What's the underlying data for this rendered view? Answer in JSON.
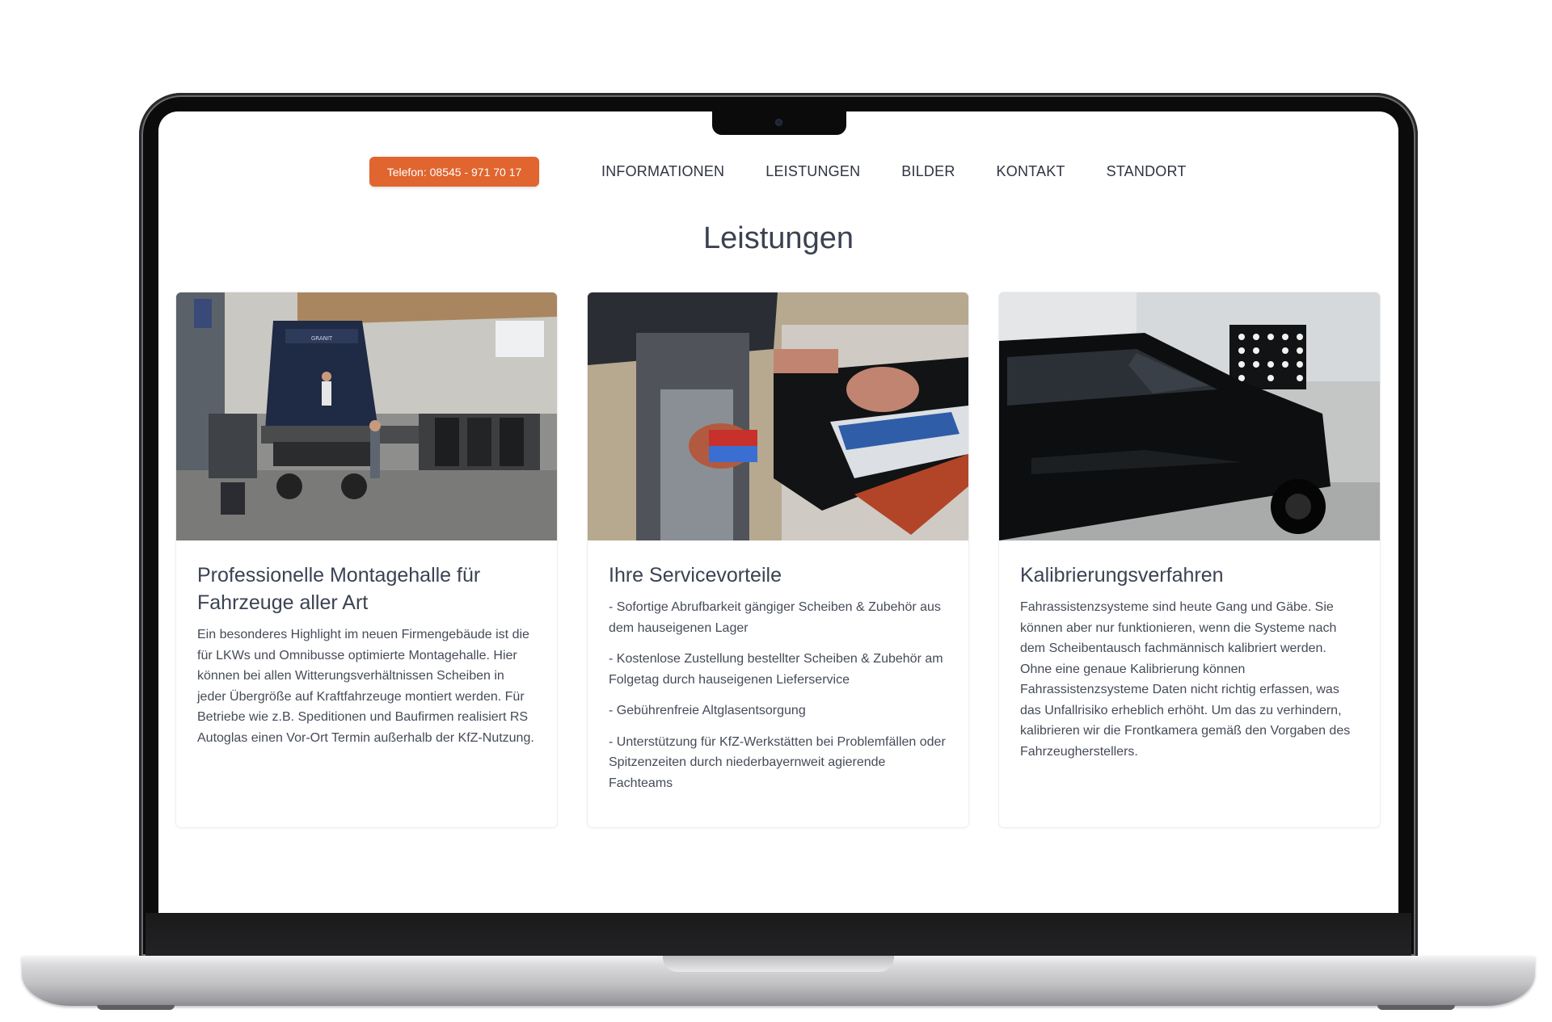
{
  "header": {
    "phone_label": "Telefon: 08545 - 971 70 17",
    "nav": [
      "INFORMATIONEN",
      "LEISTUNGEN",
      "BILDER",
      "KONTAKT",
      "STANDORT"
    ]
  },
  "main": {
    "title": "Leistungen",
    "cards": [
      {
        "image_icon": "workshop-truck-photo",
        "title": "Professionelle Montagehalle für Fahrzeuge aller Art",
        "text": "Ein besonderes Highlight im neuen Firmengebäude ist die für LKWs und Omnibusse optimierte Montagehalle. Hier können bei allen Witterungsverhältnissen Scheiben in jeder Übergröße auf Kraftfahrzeuge montiert werden. Für Betriebe wie z.B. Speditionen und Baufirmen realisiert RS Autoglas einen Vor-Ort Termin außerhalb der KfZ-Nutzung."
      },
      {
        "image_icon": "windshield-glue-photo",
        "title": "Ihre Servicevorteile",
        "items": [
          "- Sofortige Abrufbarkeit gängiger Scheiben & Zubehör aus dem hauseigenen Lager",
          "- Kostenlose Zustellung bestellter Scheiben & Zubehör am Folgetag durch hauseigenen Lieferservice",
          "- Gebührenfreie Altglasentsorgung",
          "- Unterstützung für KfZ-Werkstätten bei Problemfällen oder Spitzenzeiten durch niederbayernweit agierende Fachteams"
        ]
      },
      {
        "image_icon": "car-calibration-photo",
        "title": "Kalibrierungsverfahren",
        "text": "Fahrassistenzsysteme sind heute Gang und Gäbe. Sie können aber nur funktionieren, wenn die Systeme nach dem Scheibentausch fachmännisch kalibriert werden. Ohne eine genaue Kalibrierung können Fahrassistenzsysteme Daten nicht richtig erfassen, was das Unfallrisiko erheblich erhöht. Um das zu verhindern, kalibrieren wir die Frontkamera gemäß den Vorgaben des Fahrzeugherstellers."
      }
    ]
  },
  "colors": {
    "accent": "#e0652f",
    "text": "#3b4252"
  }
}
